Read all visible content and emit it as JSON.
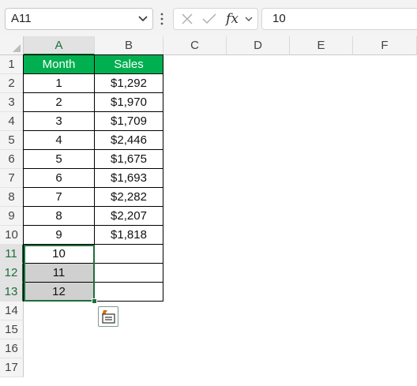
{
  "formula_bar": {
    "name_box": "A11",
    "formula_value": "10",
    "fx_label": "fx"
  },
  "columns": [
    "A",
    "B",
    "C",
    "D",
    "E",
    "F"
  ],
  "rows": [
    "1",
    "2",
    "3",
    "4",
    "5",
    "6",
    "7",
    "8",
    "9",
    "10",
    "11",
    "12",
    "13",
    "14",
    "15",
    "16",
    "17"
  ],
  "table": {
    "headers": [
      "Month",
      "Sales"
    ],
    "header_color": "#00b050",
    "rows": [
      [
        "1",
        "$1,292"
      ],
      [
        "2",
        "$1,970"
      ],
      [
        "3",
        "$1,709"
      ],
      [
        "4",
        "$2,446"
      ],
      [
        "5",
        "$1,675"
      ],
      [
        "6",
        "$1,693"
      ],
      [
        "7",
        "$2,282"
      ],
      [
        "8",
        "$2,207"
      ],
      [
        "9",
        "$1,818"
      ],
      [
        "10",
        ""
      ],
      [
        "11",
        ""
      ],
      [
        "12",
        ""
      ]
    ]
  },
  "selection": {
    "range": "A11:A13",
    "active_cell": "A11",
    "highlight_color": "#d0d0d0",
    "accent_color": "#1e6e3e"
  },
  "icons": {
    "name_box_dropdown": "chevron-down-icon",
    "cancel": "close-icon",
    "enter": "check-icon",
    "autofill_options": "autofill-options-icon"
  }
}
